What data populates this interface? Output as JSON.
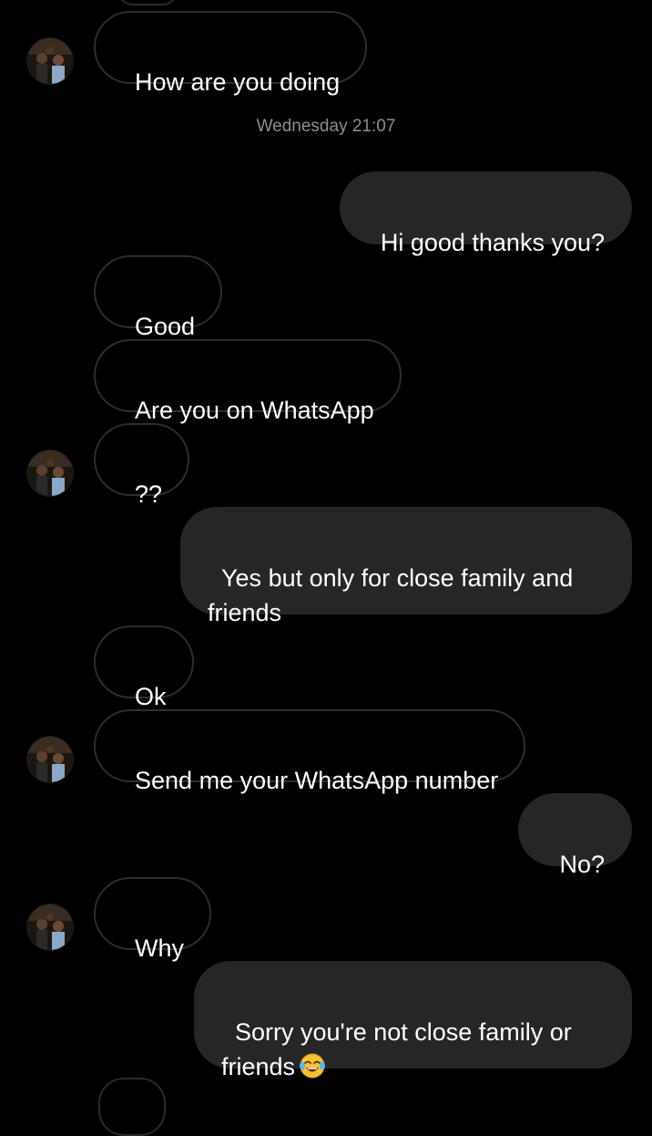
{
  "conversation": {
    "timestamp": "Wednesday 21:07",
    "messages": [
      {
        "text": "How are you doing"
      },
      {
        "text": "Hi good thanks you?"
      },
      {
        "text": "Good"
      },
      {
        "text": "Are you on WhatsApp"
      },
      {
        "text": "??"
      },
      {
        "text": "Yes but only for close family and friends"
      },
      {
        "text": "Ok"
      },
      {
        "text": "Send me your WhatsApp number"
      },
      {
        "text": "No?"
      },
      {
        "text": "Why"
      },
      {
        "text": "Sorry you're not close family or friends"
      }
    ],
    "emoji": "face-with-tears-of-joy-icon"
  },
  "colors": {
    "background": "#000000",
    "outgoing_bubble": "#262626",
    "incoming_border": "#2e2e2e",
    "timestamp_text": "#8e8e8e"
  }
}
